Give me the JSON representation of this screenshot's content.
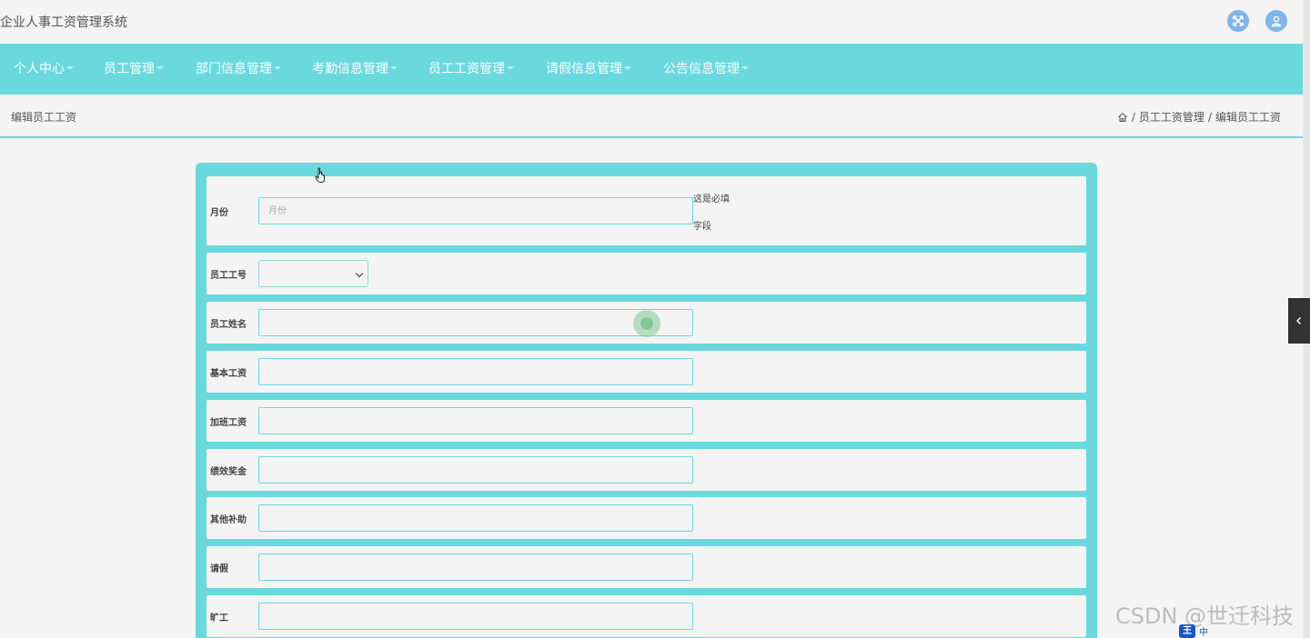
{
  "app": {
    "title": "企业人事工资管理系统"
  },
  "nav": {
    "items": [
      {
        "label": "个人中心"
      },
      {
        "label": "员工管理"
      },
      {
        "label": "部门信息管理"
      },
      {
        "label": "考勤信息管理"
      },
      {
        "label": "员工工资管理"
      },
      {
        "label": "请假信息管理"
      },
      {
        "label": "公告信息管理"
      }
    ]
  },
  "header": {
    "page_title": "编辑员工工资",
    "breadcrumb": [
      "员工工资管理",
      "编辑员工工资"
    ],
    "separator": "/"
  },
  "form": {
    "fields": [
      {
        "label": "月份",
        "placeholder": "月份",
        "value": "",
        "type": "text",
        "hint_line1": "这是必填",
        "hint_line2": "字段"
      },
      {
        "label": "员工工号",
        "value": "",
        "type": "select"
      },
      {
        "label": "员工姓名",
        "value": "",
        "type": "text"
      },
      {
        "label": "基本工资",
        "value": "",
        "type": "text"
      },
      {
        "label": "加班工资",
        "value": "",
        "type": "text"
      },
      {
        "label": "绩效奖金",
        "value": "",
        "type": "text"
      },
      {
        "label": "其他补助",
        "value": "",
        "type": "text"
      },
      {
        "label": "请假",
        "value": "",
        "type": "text"
      },
      {
        "label": "旷工",
        "value": "",
        "type": "text"
      }
    ]
  },
  "watermark": "CSDN @世迁科技",
  "ime": {
    "logo": "王",
    "mode": "中"
  },
  "colors": {
    "accent": "#69d9dd",
    "icon_blue": "#7fb6ea",
    "background": "#f4f4f4"
  }
}
